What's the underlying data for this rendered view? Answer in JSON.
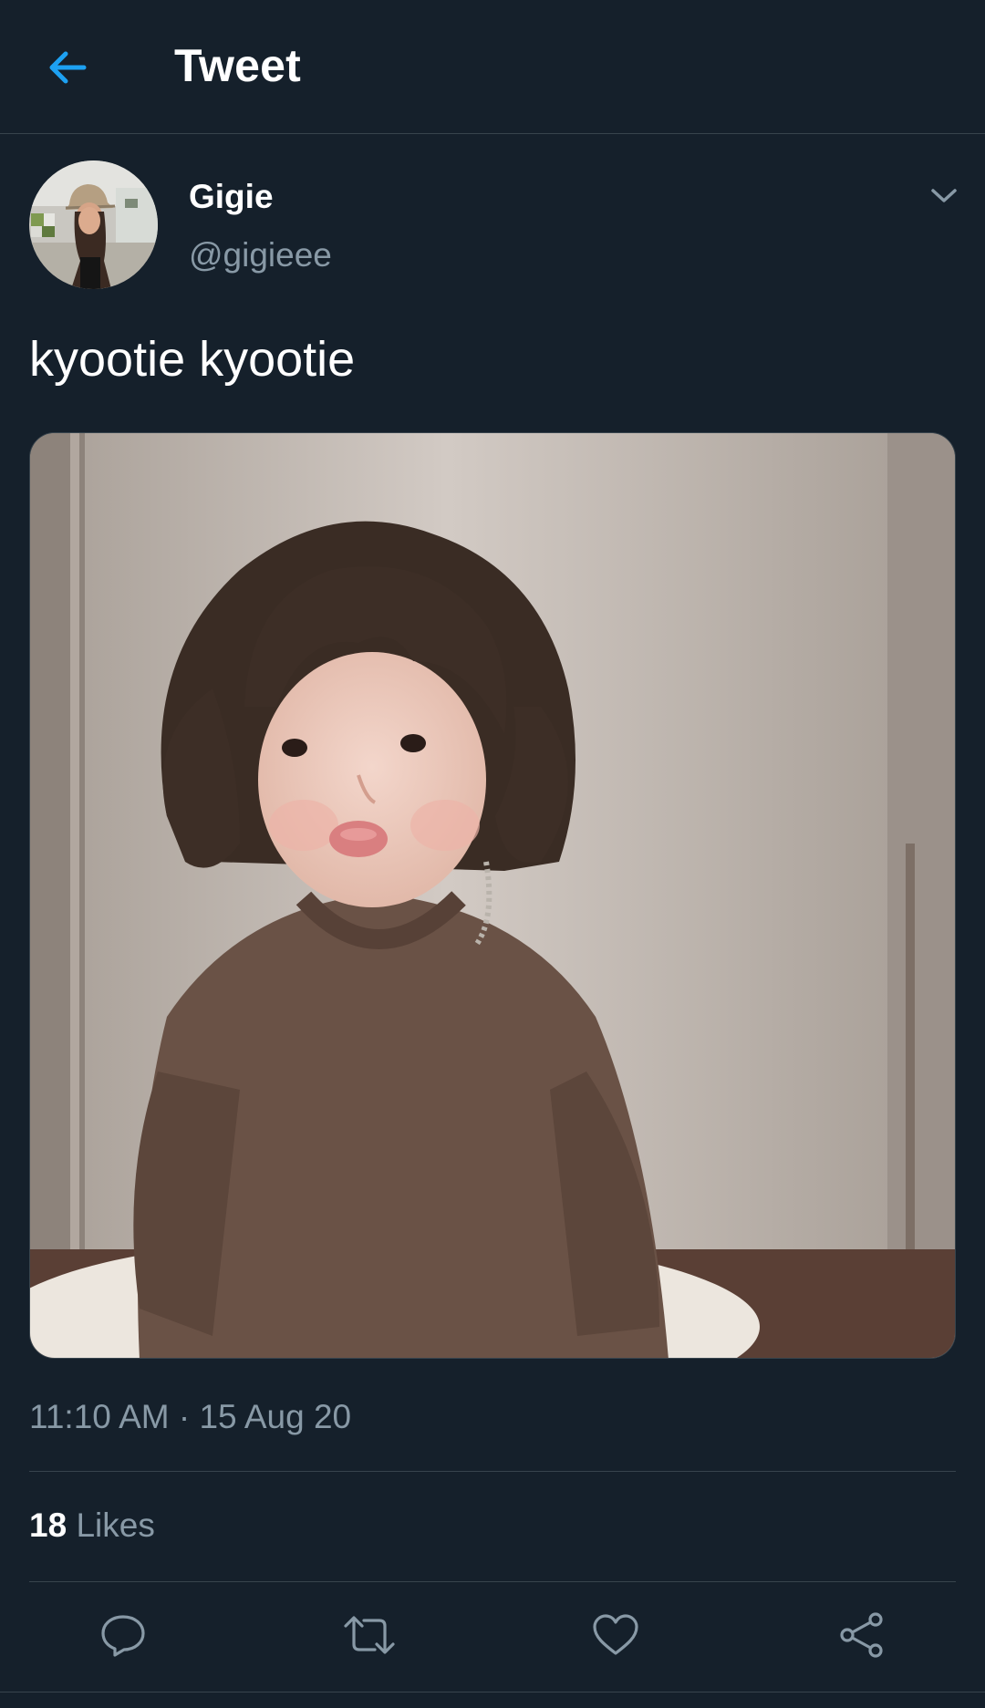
{
  "header": {
    "title": "Tweet",
    "back_icon": "arrow-left-icon",
    "accent_color": "#1da1f2"
  },
  "tweet": {
    "author": {
      "display_name": "Gigie",
      "handle": "@gigieee"
    },
    "text": "kyootie kyootie",
    "media": {
      "type": "photo"
    },
    "timestamp": "11:10 AM · 15 Aug 20",
    "likes": {
      "count": "18",
      "label": "Likes"
    },
    "actions": [
      {
        "name": "reply",
        "icon": "reply-icon"
      },
      {
        "name": "retweet",
        "icon": "retweet-icon"
      },
      {
        "name": "like",
        "icon": "heart-icon"
      },
      {
        "name": "share",
        "icon": "share-icon"
      }
    ]
  },
  "colors": {
    "background": "#15202b",
    "secondary_text": "#8899a6",
    "divider": "#38444d"
  }
}
